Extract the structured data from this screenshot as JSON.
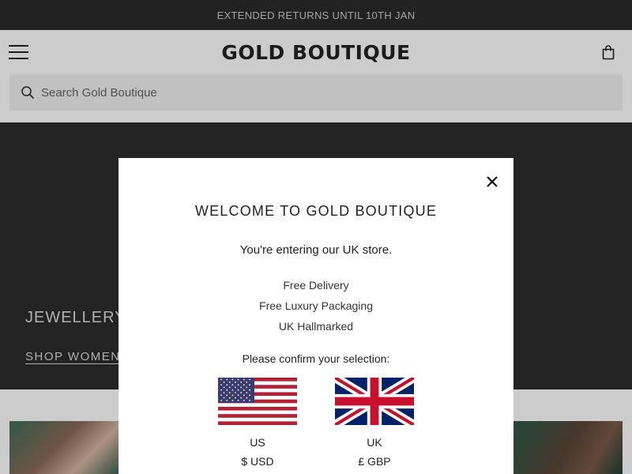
{
  "promo": {
    "text": "EXTENDED RETURNS UNTIL 10TH JAN"
  },
  "header": {
    "logo": "GOLD BOUTIQUE"
  },
  "search": {
    "placeholder": "Search Gold Boutique",
    "value": ""
  },
  "hero": {
    "title": "JEWELLERY",
    "link": "SHOP WOMEN'S"
  },
  "modal": {
    "title": "WELCOME TO GOLD BOUTIQUE",
    "subtitle": "You're entering our UK store.",
    "features": [
      "Free Delivery",
      "Free Luxury Packaging",
      "UK Hallmarked"
    ],
    "confirm_text": "Please confirm your selection:",
    "options": [
      {
        "name": "US",
        "currency": "$ USD",
        "flag": "us-flag"
      },
      {
        "name": "UK",
        "currency": "£ GBP",
        "flag": "uk-flag"
      }
    ]
  },
  "colors": {
    "dark": "#2b2b2b",
    "text": "#222222"
  },
  "icons": [
    "hamburger-menu-icon",
    "shopping-bag-icon",
    "search-icon",
    "close-icon"
  ]
}
